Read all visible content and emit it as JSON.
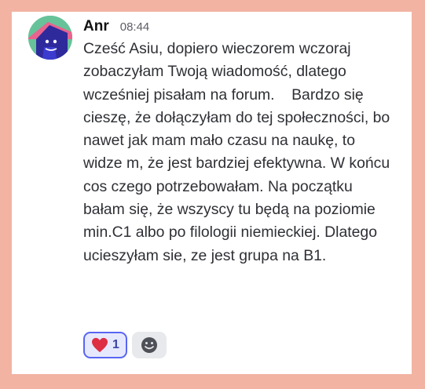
{
  "message": {
    "author": "Anr",
    "timestamp": "08:44",
    "text": "Cześć Asiu, dopiero wieczorem wczoraj zobaczyłam Twoją wiadomość, dlatego wcześniej pisałam na forum.    Bardzo się cieszę, że dołączyłam do tej społeczności, bo nawet jak mam mało czasu na naukę, to widze m, że jest bardziej efektywna. W końcu cos czego potrzebowałam. Na początku bałam się, że wszyscy tu będą na poziomie min.C1 albo po filologii niemieckiej. Dlatego ucieszyłam sie, ze jest grupa na B1."
  },
  "reactions": [
    {
      "emoji": "heart-emoji",
      "count": "1",
      "selected": true
    }
  ],
  "add_reaction_icon": "smiley-add-reaction-icon",
  "colors": {
    "page_background": "#f2b3a3",
    "card_background": "#ffffff",
    "reaction_accent": "#5865f2"
  }
}
